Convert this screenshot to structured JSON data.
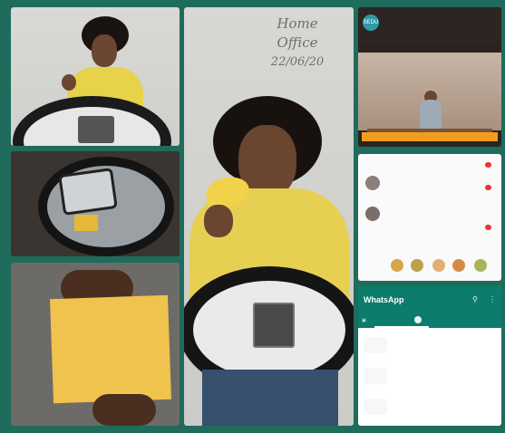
{
  "caption": {
    "line1": "Home",
    "line2": "Office",
    "date": "22/06/20"
  },
  "youtube": {
    "logo_text": "SEDU",
    "channel": "",
    "subtitle": "",
    "description": "",
    "banner": ""
  },
  "comments": {
    "items": [
      {
        "name": "",
        "text": "",
        "time": "",
        "like": "",
        "reply": ""
      },
      {
        "name": "",
        "text": "",
        "time": "",
        "like": "",
        "reply": ""
      },
      {
        "name": "",
        "text": "",
        "time": "",
        "like": "",
        "reply": ""
      }
    ]
  },
  "whatsapp": {
    "title": "WhatsApp",
    "tabs": [
      "",
      "",
      ""
    ],
    "badge": "",
    "chats": [
      {
        "name": "",
        "sub": "",
        "time": ""
      },
      {
        "name": "",
        "sub": "",
        "time": ""
      },
      {
        "name": "",
        "sub": "",
        "time": ""
      }
    ]
  },
  "colors": {
    "border": "#1f6b5c",
    "shirt": "#e7cf52",
    "whatsapp": "#0c7c6c",
    "accent": "#f39c1e"
  },
  "icons": {
    "search": "search-icon",
    "menu": "more-vertical-icon",
    "camera": "camera-icon"
  }
}
